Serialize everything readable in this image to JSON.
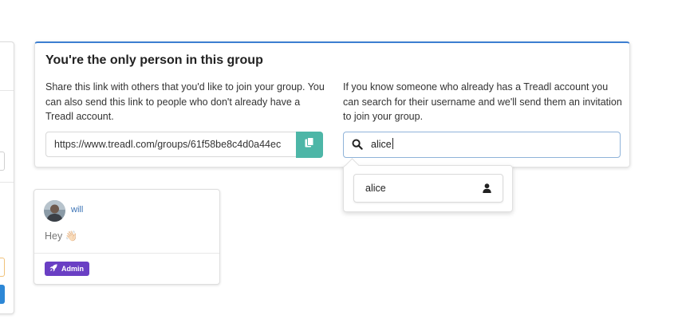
{
  "share_card": {
    "title": "You're the only person in this group",
    "left_description": "Share this link with others that you'd like to join your group. You can also send this link to people who don't already have a Treadl account.",
    "link_value": "https://www.treadl.com/groups/61f58be8c4d0a44ec",
    "right_description": "If you know someone who already has a Treadl account you can search for their username and we'll send them an invitation to join your group.",
    "search_value": "alice"
  },
  "suggestions": [
    {
      "username": "alice"
    }
  ],
  "post": {
    "author": "will",
    "text": "Hey 👋🏻",
    "badge_label": "Admin"
  },
  "colors": {
    "accent_blue": "#3d7fd1",
    "copy_button": "#4db6a7",
    "admin_badge": "#6a3fc4",
    "link_text": "#3a72b5"
  },
  "icons": {
    "copy": "copy-icon",
    "search": "search-icon",
    "user": "user-icon",
    "rocket": "rocket-icon"
  }
}
